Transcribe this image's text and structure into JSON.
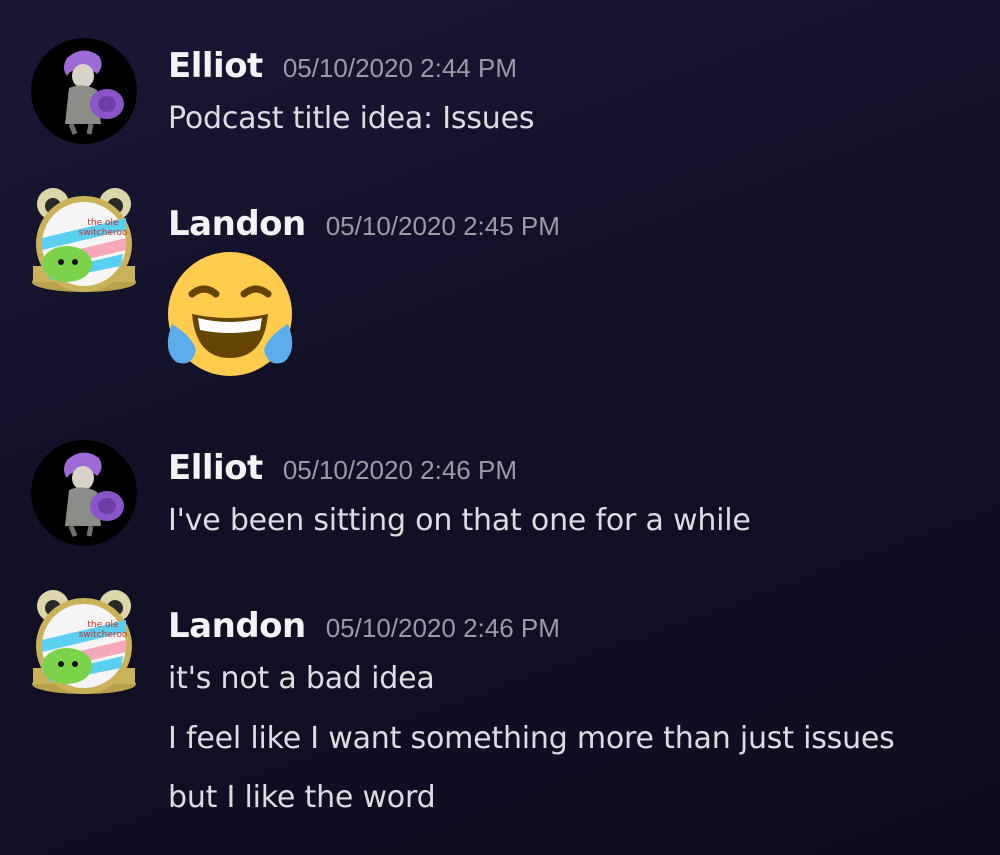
{
  "messages": [
    {
      "author": "Elliot",
      "timestamp": "05/10/2020 2:44 PM",
      "avatar_icon": "purple-hair-character-avatar",
      "lines": [
        "Podcast title idea: Issues"
      ]
    },
    {
      "author": "Landon",
      "timestamp": "05/10/2020 2:45 PM",
      "avatar_icon": "frog-pride-badge-avatar",
      "avatar_text": [
        "the ole",
        "switcheroo"
      ],
      "emoji": "face-with-tears-of-joy-emoji"
    },
    {
      "author": "Elliot",
      "timestamp": "05/10/2020 2:46 PM",
      "avatar_icon": "purple-hair-character-avatar",
      "lines": [
        "I've been sitting on that one for a while"
      ]
    },
    {
      "author": "Landon",
      "timestamp": "05/10/2020 2:46 PM",
      "avatar_icon": "frog-pride-badge-avatar",
      "avatar_text": [
        "the ole",
        "switcheroo"
      ],
      "lines": [
        "it's not a bad idea",
        "I feel like I want something more than just issues",
        "but I like the word"
      ]
    }
  ],
  "colors": {
    "username": "#f2f3f5",
    "timestamp": "#9a9ba3",
    "message_text": "#dbdee1",
    "background_top": "#1a1735",
    "background_bottom": "#0e0d1f"
  }
}
